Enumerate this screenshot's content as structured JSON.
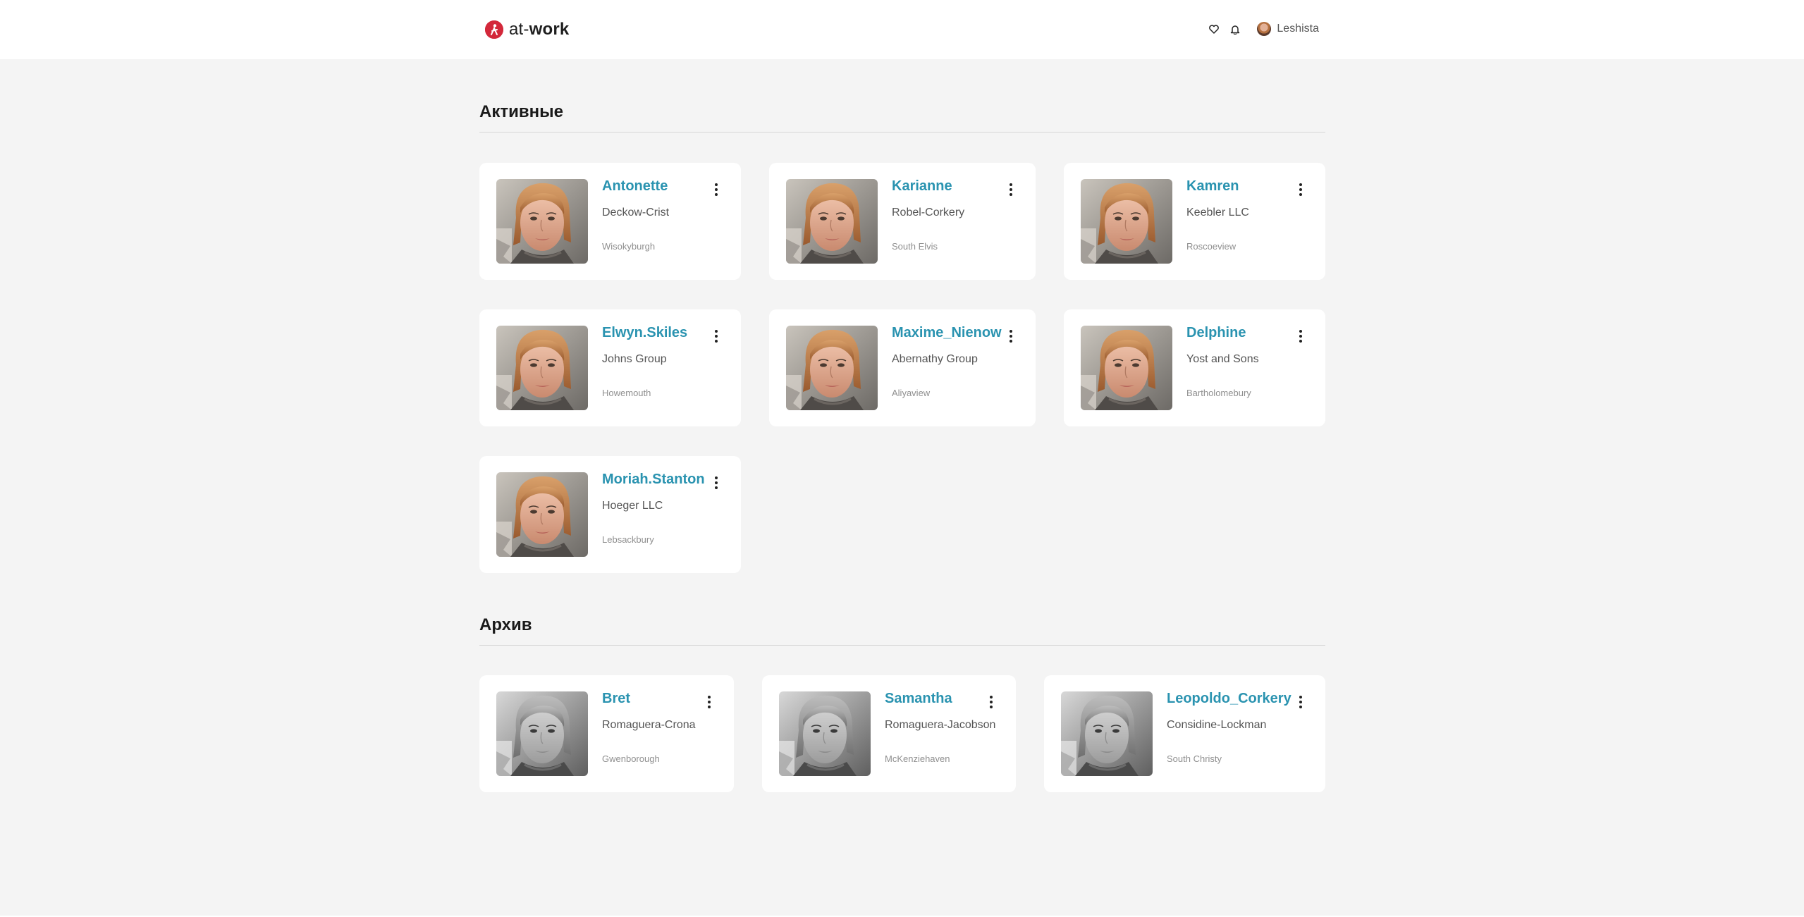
{
  "header": {
    "logo_prefix": "at-",
    "logo_suffix": "work",
    "user_name": "Leshista",
    "brand_color": "#d3283a"
  },
  "sections": {
    "active_title": "Активные",
    "archive_title": "Архив"
  },
  "active": [
    {
      "name": "Antonette",
      "company": "Deckow-Crist",
      "city": "Wisokyburgh"
    },
    {
      "name": "Karianne",
      "company": "Robel-Corkery",
      "city": "South Elvis"
    },
    {
      "name": "Kamren",
      "company": "Keebler LLC",
      "city": "Roscoeview"
    },
    {
      "name": "Elwyn.Skiles",
      "company": "Johns Group",
      "city": "Howemouth"
    },
    {
      "name": "Maxime_Nienow",
      "company": "Abernathy Group",
      "city": "Aliyaview"
    },
    {
      "name": "Delphine",
      "company": "Yost and Sons",
      "city": "Bartholomebury"
    },
    {
      "name": "Moriah.Stanton",
      "company": "Hoeger LLC",
      "city": "Lebsackbury"
    }
  ],
  "archive": [
    {
      "name": "Bret",
      "company": "Romaguera-Crona",
      "city": "Gwenborough"
    },
    {
      "name": "Samantha",
      "company": "Romaguera-Jacobson",
      "city": "McKenziehaven"
    },
    {
      "name": "Leopoldo_Corkery",
      "company": "Considine-Lockman",
      "city": "South Christy"
    }
  ],
  "icons": {
    "favorites": "heart-icon",
    "notifications": "bell-icon",
    "card_menu": "more-vertical-icon"
  },
  "colors": {
    "name_link": "#2a93b0",
    "background": "#f4f4f4",
    "card": "#ffffff"
  }
}
